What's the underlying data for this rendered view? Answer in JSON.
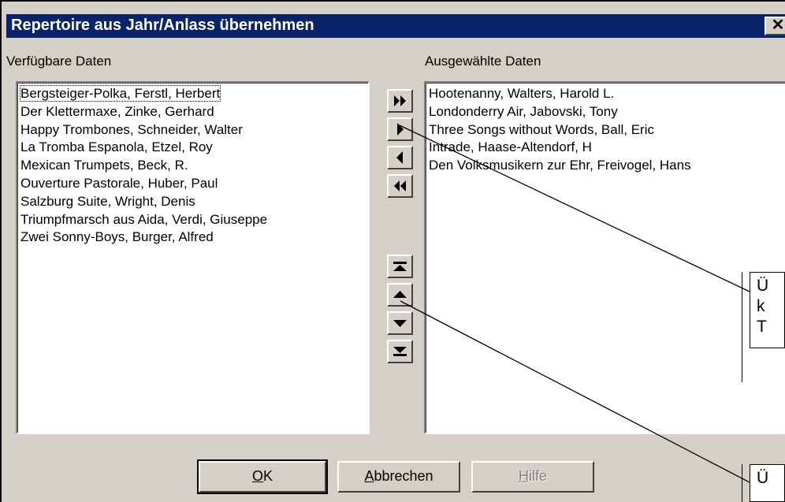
{
  "window": {
    "title": "Repertoire aus Jahr/Anlass übernehmen",
    "close_glyph": "✕"
  },
  "left_panel": {
    "label": "Verfügbare Daten",
    "items": [
      "Bergsteiger-Polka, Ferstl, Herbert",
      "Der Klettermaxe, Zinke, Gerhard",
      "Happy Trombones, Schneider, Walter",
      "La Tromba Espanola, Etzel, Roy",
      "Mexican Trumpets, Beck, R.",
      "Ouverture Pastorale, Huber, Paul",
      "Salzburg Suite, Wright, Denis",
      "Triumpfmarsch aus Aida, Verdi, Giuseppe",
      "Zwei Sonny-Boys, Burger, Alfred"
    ]
  },
  "right_panel": {
    "label": "Ausgewählte Daten",
    "items": [
      "Hootenanny, Walters, Harold L.",
      "Londonderry Air, Jabovski, Tony",
      "Three Songs without Words, Ball, Eric",
      "Intrade, Haase-Altendorf, H",
      "Den Volksmusikern zur Ehr, Freivogel, Hans"
    ]
  },
  "move_buttons": {
    "transfer": [
      "move-all-right-icon",
      "move-right-icon",
      "move-left-icon",
      "move-all-left-icon"
    ],
    "order": [
      "move-to-top-icon",
      "move-up-icon",
      "move-down-icon",
      "move-to-bottom-icon"
    ]
  },
  "buttons": {
    "ok_mnemonic": "O",
    "ok_rest": "K",
    "cancel_mnemonic": "A",
    "cancel_rest": "bbrechen",
    "help_mnemonic": "H",
    "help_rest": "ilfe"
  },
  "callouts": {
    "first": [
      "Ü",
      "k",
      "T"
    ],
    "second": [
      "Ü"
    ]
  },
  "colors": {
    "titlebar": "#0a246a",
    "dialog_face": "#d4d0c8"
  }
}
